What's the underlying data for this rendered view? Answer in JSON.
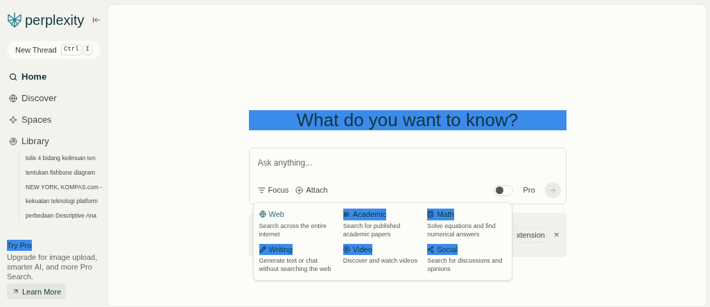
{
  "brand": "perplexity",
  "new_thread": {
    "label": "New Thread",
    "keys": [
      "Ctrl",
      "I"
    ]
  },
  "nav": [
    {
      "label": "Home",
      "selected": true
    },
    {
      "label": "Discover",
      "selected": false
    },
    {
      "label": "Spaces",
      "selected": false
    },
    {
      "label": "Library",
      "selected": false
    }
  ],
  "library_items": [
    "tulis 4 bidang keilmuan ten",
    "tentukan fishbone diagram",
    "NEW YORK, KOMPAS.com -",
    "kekuatan teknologi platform",
    "perbedaan Descriptive Ana"
  ],
  "promo": {
    "title": "Try Pro",
    "title_highlighted": true,
    "text": "Upgrade for image upload, smarter AI, and more Pro Search.",
    "button": "Learn More"
  },
  "heading": {
    "text": "What do you want to know?",
    "highlighted": true
  },
  "search": {
    "placeholder": "Ask anything...",
    "focus": "Focus",
    "attach": "Attach",
    "pro_label": "Pro",
    "pro_on": false
  },
  "banner": {
    "button": "xtension",
    "close": "×"
  },
  "focus_menu": [
    {
      "title": "Web",
      "description": "Search across the entire internet",
      "highlighted": false
    },
    {
      "title": "Academic",
      "description": "Search for published academic papers",
      "highlighted": true
    },
    {
      "title": "Math",
      "description": "Solve equations and find numerical answers",
      "highlighted": true
    },
    {
      "title": "Writing",
      "description": "Generate text or chat without searching the web",
      "highlighted": true
    },
    {
      "title": "Video",
      "description": "Discover and watch videos",
      "highlighted": true
    },
    {
      "title": "Social",
      "description": "Search for discussions and opinions",
      "highlighted": true
    }
  ]
}
